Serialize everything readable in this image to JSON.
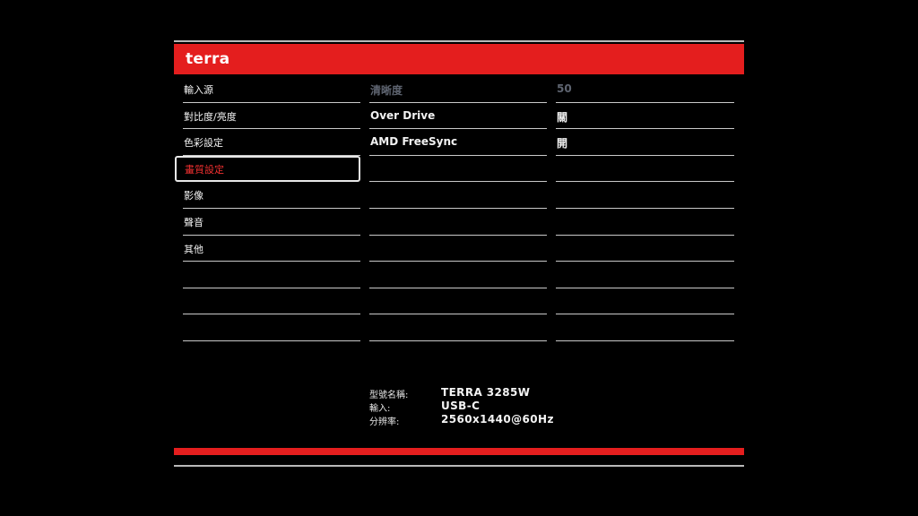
{
  "header": {
    "brand": "terra"
  },
  "menu": {
    "items": [
      {
        "label": "輸入源",
        "state": "normal"
      },
      {
        "label": "對比度/亮度",
        "state": "normal"
      },
      {
        "label": "色彩設定",
        "state": "normal"
      },
      {
        "label": "畫質設定",
        "state": "selected"
      },
      {
        "label": "影像",
        "state": "normal"
      },
      {
        "label": "聲音",
        "state": "normal"
      },
      {
        "label": "其他",
        "state": "normal"
      },
      {
        "label": "",
        "state": "empty"
      },
      {
        "label": "",
        "state": "empty"
      },
      {
        "label": "",
        "state": "empty"
      }
    ]
  },
  "options": {
    "items": [
      {
        "label": "清晰度",
        "state": "disabled",
        "value": "50"
      },
      {
        "label": "Over Drive",
        "state": "normal",
        "value": "關"
      },
      {
        "label": "AMD FreeSync",
        "state": "normal",
        "value": "開"
      },
      {
        "label": "",
        "state": "empty",
        "value": ""
      },
      {
        "label": "",
        "state": "empty",
        "value": ""
      },
      {
        "label": "",
        "state": "empty",
        "value": ""
      },
      {
        "label": "",
        "state": "empty",
        "value": ""
      },
      {
        "label": "",
        "state": "empty",
        "value": ""
      },
      {
        "label": "",
        "state": "empty",
        "value": ""
      },
      {
        "label": "",
        "state": "empty",
        "value": ""
      }
    ]
  },
  "info": {
    "model_label": "型號名稱:",
    "model_value": "TERRA 3285W",
    "input_label": "輸入:",
    "input_value": "USB-C",
    "resolution_label": "分辨率:",
    "resolution_value": "2560x1440@60Hz"
  },
  "colors": {
    "accent": "#e41e1e",
    "selected_text": "#f03030",
    "disabled_text": "#5e6470",
    "background": "#000000"
  }
}
